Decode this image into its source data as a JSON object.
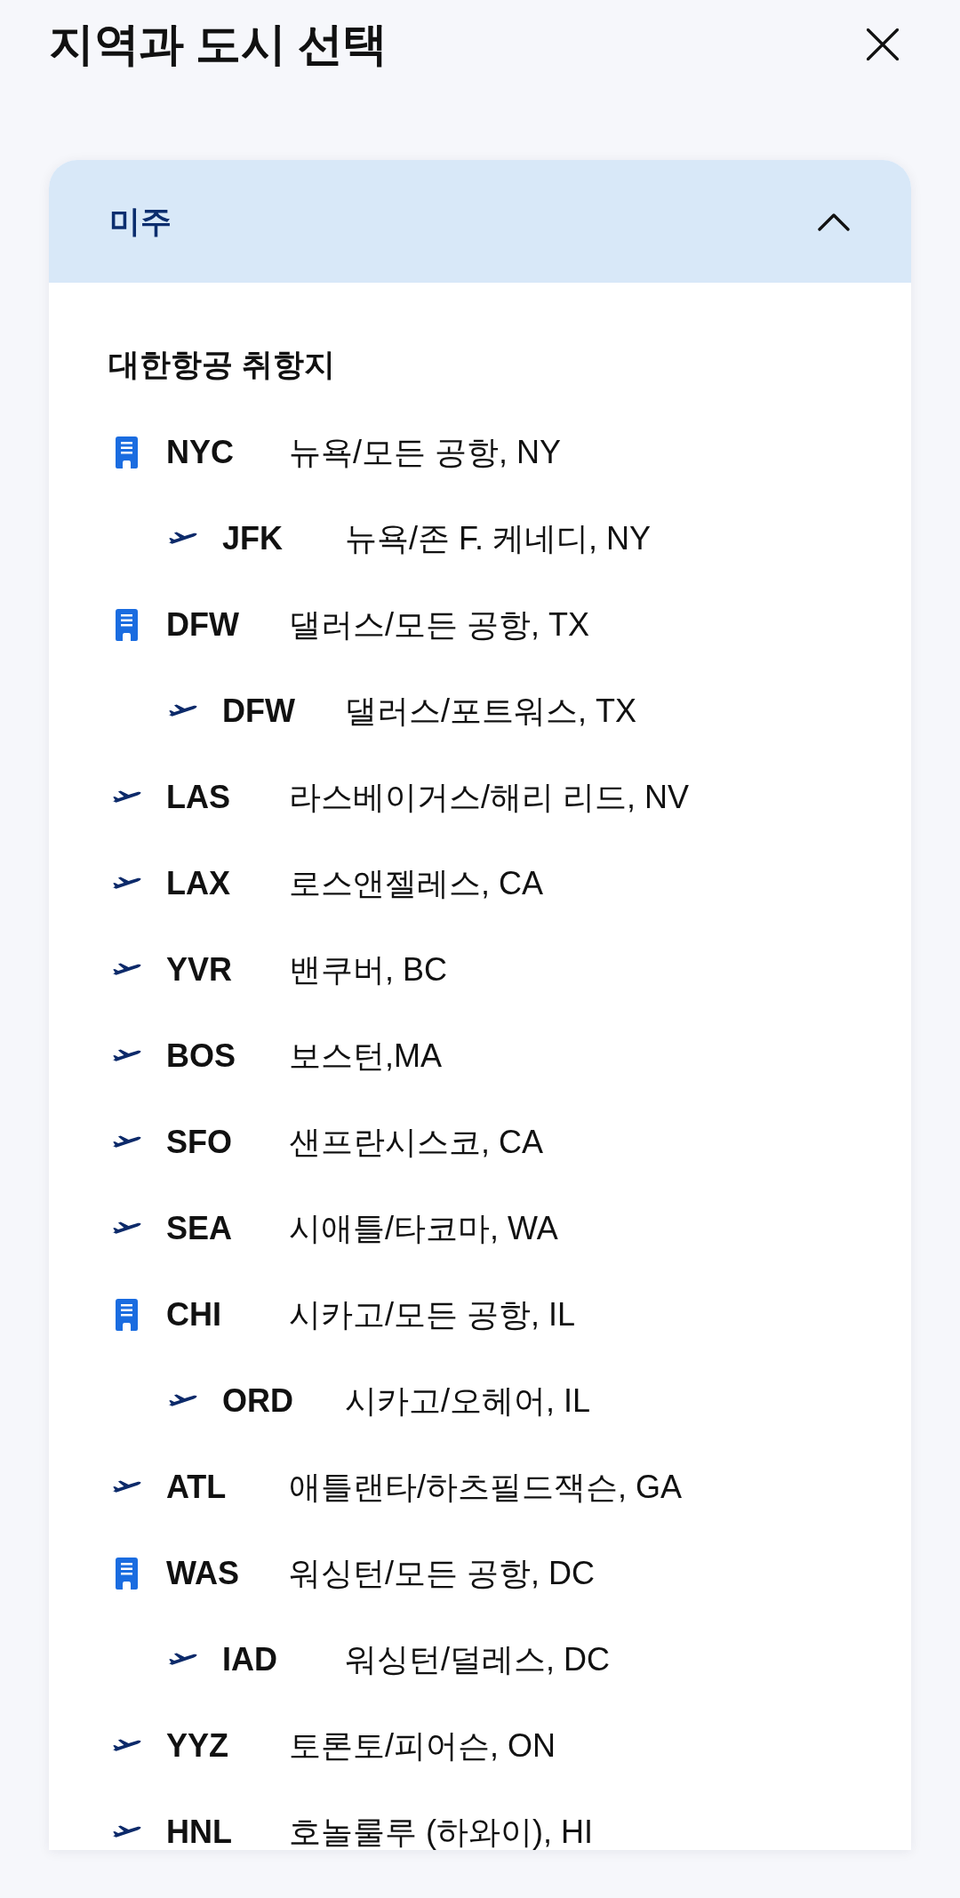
{
  "header": {
    "title": "지역과 도시 선택"
  },
  "region": {
    "label": "미주",
    "expanded": true,
    "section_title": "대한항공 취항지",
    "destinations": [
      {
        "kind": "city",
        "code": "NYC",
        "name": "뉴욕/모든 공항, NY",
        "children": [
          {
            "kind": "airport",
            "code": "JFK",
            "name": "뉴욕/존 F. 케네디, NY"
          }
        ]
      },
      {
        "kind": "city",
        "code": "DFW",
        "name": "댈러스/모든 공항, TX",
        "children": [
          {
            "kind": "airport",
            "code": "DFW",
            "name": "댈러스/포트워스, TX"
          }
        ]
      },
      {
        "kind": "airport",
        "code": "LAS",
        "name": "라스베이거스/해리 리드, NV"
      },
      {
        "kind": "airport",
        "code": "LAX",
        "name": "로스앤젤레스, CA"
      },
      {
        "kind": "airport",
        "code": "YVR",
        "name": "밴쿠버, BC"
      },
      {
        "kind": "airport",
        "code": "BOS",
        "name": "보스턴,MA"
      },
      {
        "kind": "airport",
        "code": "SFO",
        "name": "샌프란시스코, CA"
      },
      {
        "kind": "airport",
        "code": "SEA",
        "name": "시애틀/타코마, WA"
      },
      {
        "kind": "city",
        "code": "CHI",
        "name": "시카고/모든 공항, IL",
        "children": [
          {
            "kind": "airport",
            "code": "ORD",
            "name": "시카고/오헤어, IL"
          }
        ]
      },
      {
        "kind": "airport",
        "code": "ATL",
        "name": "애틀랜타/하츠필드잭슨, GA"
      },
      {
        "kind": "city",
        "code": "WAS",
        "name": "워싱턴/모든 공항, DC",
        "children": [
          {
            "kind": "airport",
            "code": "IAD",
            "name": "워싱턴/덜레스, DC"
          }
        ]
      },
      {
        "kind": "airport",
        "code": "YYZ",
        "name": "토론토/피어슨, ON"
      },
      {
        "kind": "airport",
        "code": "HNL",
        "name": "호놀룰루 (하와이), HI"
      }
    ]
  }
}
